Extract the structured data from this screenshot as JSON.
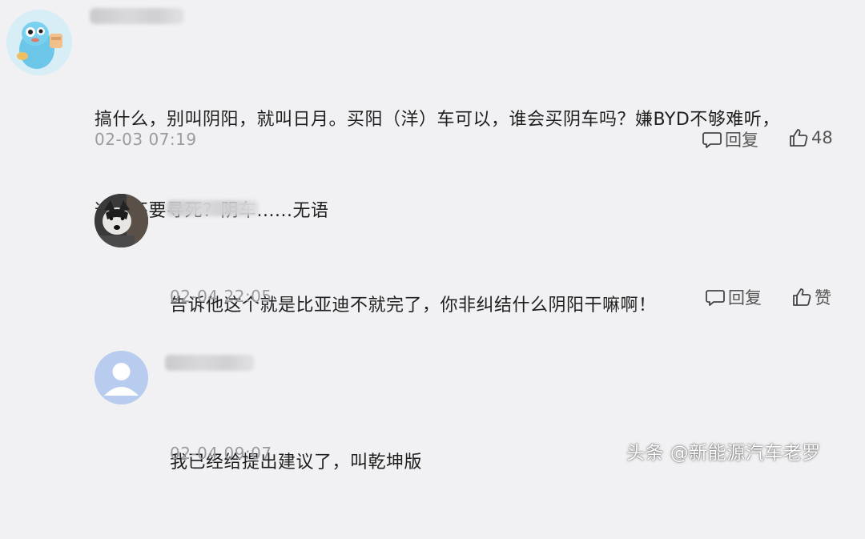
{
  "comments": [
    {
      "content_lines": [
        "搞什么，别叫阴阳，就叫日月。买阳（洋）车可以，谁会买阴车吗？嫌BYD不够难听，",
        "这回还要寻死？阴车......无语"
      ],
      "time": "02-03 07:19",
      "reply_label": "回复",
      "like_label": "48"
    },
    {
      "content_lines": [
        "告诉他这个就是比亚迪不就完了，你非纠结什么阴阳干嘛啊！"
      ],
      "time": "02-04 22:05",
      "reply_label": "回复",
      "like_label": "赞"
    },
    {
      "content_lines": [
        "我已经给提出建议了，叫乾坤版"
      ],
      "time": "02-04 09:07"
    }
  ],
  "watermark": "头条 @新能源汽车老罗",
  "icons": {
    "reply": "comment-bubble-icon",
    "like": "thumbs-up-icon"
  }
}
